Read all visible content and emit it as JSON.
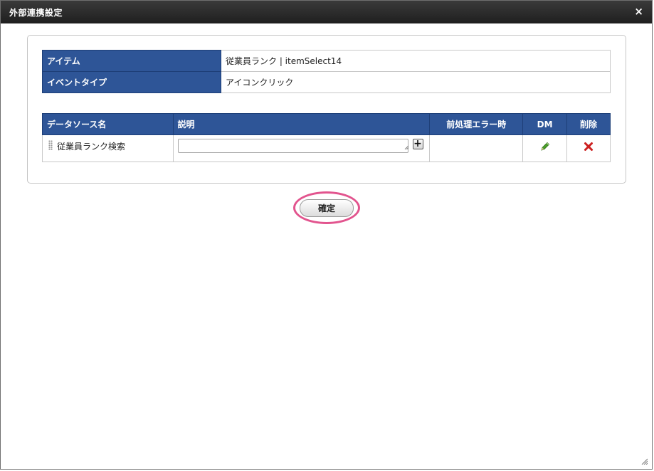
{
  "dialog": {
    "title": "外部連携設定",
    "close_icon": "×"
  },
  "info_table": {
    "rows": [
      {
        "label": "アイテム",
        "value": "従業員ランク | itemSelect14"
      },
      {
        "label": "イベントタイプ",
        "value": "アイコンクリック"
      }
    ]
  },
  "datasource_table": {
    "headers": {
      "name": "データソース名",
      "description": "説明",
      "preprocess_error": "前処理エラー時",
      "dm": "DM",
      "delete": "削除"
    },
    "rows": [
      {
        "name": "従業員ランク検索",
        "description": "",
        "preprocess_error": ""
      }
    ],
    "add_button": "+"
  },
  "footer": {
    "confirm_label": "確定"
  },
  "colors": {
    "header_bg": "#2e5597",
    "highlight": "#e2548e",
    "edit_icon": "#4a9e2a",
    "delete_icon": "#cc1f1f"
  },
  "icons": [
    "close-icon",
    "drag-handle-icon",
    "plus-icon",
    "pencil-icon",
    "delete-x-icon",
    "resize-grip-icon"
  ]
}
